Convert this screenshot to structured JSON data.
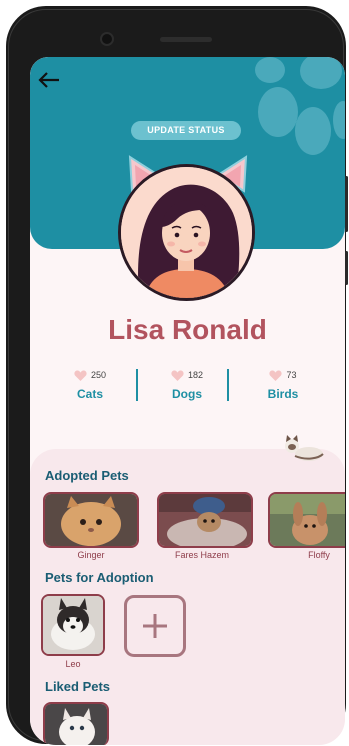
{
  "header": {
    "status_button_label": "UPDATE STATUS"
  },
  "profile": {
    "name": "Lisa Ronald"
  },
  "stats": [
    {
      "count": "250",
      "label": "Cats"
    },
    {
      "count": "182",
      "label": "Dogs"
    },
    {
      "count": "73",
      "label": "Birds"
    }
  ],
  "adopted": {
    "title": "Adopted Pets",
    "pets": [
      {
        "name": "Ginger"
      },
      {
        "name": "Fares Hazem"
      },
      {
        "name": "Floffy"
      }
    ]
  },
  "for_adoption": {
    "title": "Pets for Adoption",
    "pets": [
      {
        "name": "Leo"
      }
    ]
  },
  "liked": {
    "title": "Liked Pets"
  },
  "icons": {
    "back": "arrow-left-icon",
    "stat": "heart-icon",
    "add": "plus-icon"
  },
  "colors": {
    "teal": "#1e8fa3",
    "rose": "#b2535e",
    "panel": "#f8e8ec",
    "border": "#8e3d4a"
  }
}
